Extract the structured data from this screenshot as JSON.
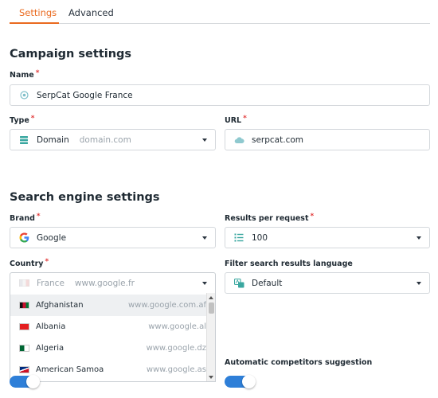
{
  "tabs": [
    {
      "label": "Settings",
      "active": true
    },
    {
      "label": "Advanced",
      "active": false
    }
  ],
  "campaign": {
    "title": "Campaign settings",
    "name": {
      "label": "Name",
      "value": "SerpCat Google France",
      "icon": "target-icon"
    },
    "type": {
      "label": "Type",
      "value": "Domain",
      "sub": "domain.com",
      "icon": "stack-icon"
    },
    "url": {
      "label": "URL",
      "value": "serpcat.com",
      "icon": "cloud-icon"
    }
  },
  "search_engine": {
    "title": "Search engine settings",
    "brand": {
      "label": "Brand",
      "value": "Google",
      "icon": "google-icon"
    },
    "results_per_request": {
      "label": "Results per request",
      "value": "100",
      "icon": "list-icon"
    },
    "country": {
      "label": "Country",
      "value": "France",
      "sub": "www.google.fr",
      "icon": "flag-icon"
    },
    "filter_language": {
      "label": "Filter search results language",
      "value": "Default",
      "icon": "translate-icon"
    },
    "country_options": [
      {
        "name": "Afghanistan",
        "url": "www.google.com.af"
      },
      {
        "name": "Albania",
        "url": "www.google.al"
      },
      {
        "name": "Algeria",
        "url": "www.google.dz"
      },
      {
        "name": "American Samoa",
        "url": "www.google.as"
      }
    ],
    "automatic_competitors": {
      "label": "Automatic competitors suggestion",
      "enabled": true
    }
  },
  "required_mark": "*",
  "colors": {
    "accent": "#ea6a1f",
    "toggle": "#2e7fd8",
    "required": "#e23b3b"
  }
}
